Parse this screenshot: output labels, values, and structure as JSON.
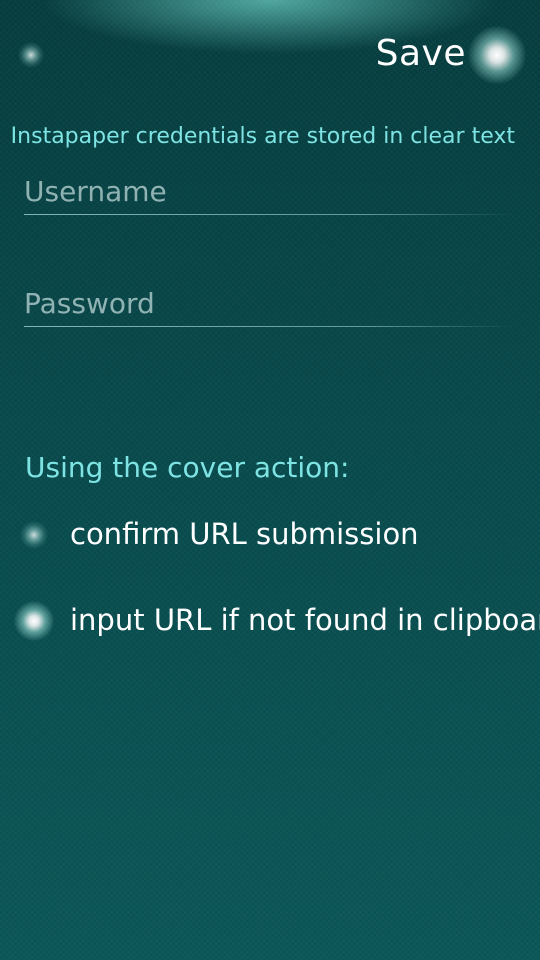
{
  "header": {
    "save_label": "Save"
  },
  "hint": "Instapaper credentials are stored in clear text",
  "form": {
    "username": {
      "value": "",
      "placeholder": "Username"
    },
    "password": {
      "value": "",
      "placeholder": "Password"
    }
  },
  "cover_action": {
    "title": "Using the cover action:",
    "options": [
      {
        "label": "confirm URL submission",
        "checked": false
      },
      {
        "label": "input URL if not found in clipboard",
        "checked": true
      }
    ]
  },
  "colors": {
    "background": "#08484a",
    "highlight": "#7ee3e3",
    "text": "#ffffff"
  }
}
